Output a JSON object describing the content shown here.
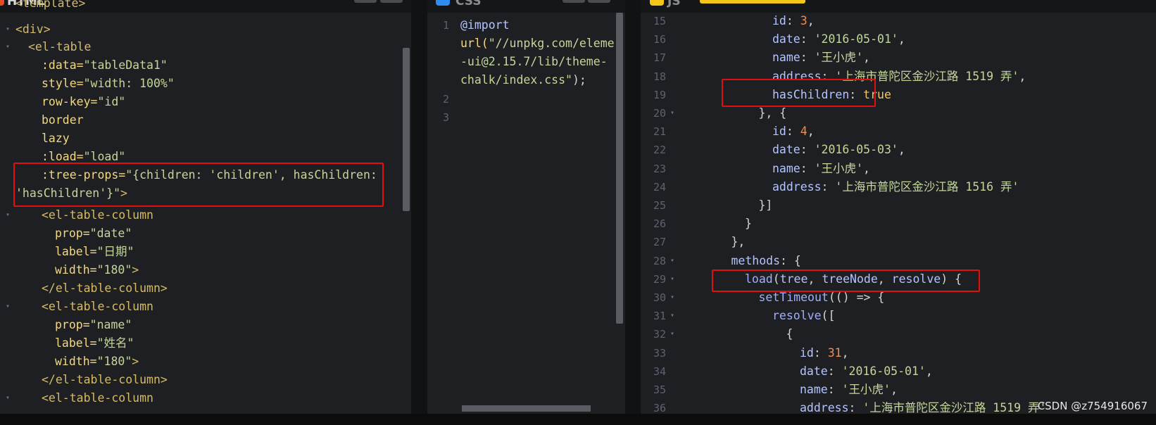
{
  "panels": {
    "html_tab": "HTML",
    "css_tab": "CSS",
    "js_tab": "JS",
    "css_tab_icon": "css-badge-icon",
    "js_tab_icon": "js-badge-icon",
    "html_tab_icon": "html-badge-icon"
  },
  "html_code": {
    "l0": "<template>",
    "l1": "<div>",
    "l2": "<el-table",
    "l3a": ":data=",
    "l3b": "\"tableData1\"",
    "l4a": "style=",
    "l4b": "\"width: 100%\"",
    "l5a": "row-key=",
    "l5b": "\"id\"",
    "l6": "border",
    "l7": "lazy",
    "l8a": ":load=",
    "l8b": "\"load\"",
    "l9a": ":tree-props=",
    "l9b": "\"{children: 'children', hasChildren:",
    "l10a": "'hasChildren'}\"",
    "l10b": ">",
    "l11": "<el-table-column",
    "l12a": "prop=",
    "l12b": "\"date\"",
    "l13a": "label=",
    "l13b": "\"日期\"",
    "l14a": "width=",
    "l14b": "\"180\"",
    "l14c": ">",
    "l15": "</el-table-column>",
    "l16": "<el-table-column",
    "l17a": "prop=",
    "l17b": "\"name\"",
    "l18a": "label=",
    "l18b": "\"姓名\"",
    "l19a": "width=",
    "l19b": "\"180\"",
    "l19c": ">",
    "l20": "</el-table-column>",
    "l21": "<el-table-column"
  },
  "css_code": {
    "n1": "1",
    "n2": "2",
    "n3": "3",
    "l1": "@import",
    "l2a": "url(",
    "l2b": "\"//unpkg.com/eleme",
    "l3": "-ui@2.15.7/lib/theme-",
    "l4": "chalk/index.css\"",
    "l4b": ");"
  },
  "js_code": {
    "lines": [
      {
        "n": "15",
        "text": [
          [
            "prop",
            "id"
          ],
          [
            "pun",
            ": "
          ],
          [
            "num",
            "3"
          ],
          [
            "pun",
            ","
          ]
        ],
        "indent": 6
      },
      {
        "n": "16",
        "text": [
          [
            "prop",
            "date"
          ],
          [
            "pun",
            ": "
          ],
          [
            "str",
            "'2016-05-01'"
          ],
          [
            "pun",
            ","
          ]
        ],
        "indent": 6
      },
      {
        "n": "17",
        "text": [
          [
            "prop",
            "name"
          ],
          [
            "pun",
            ": "
          ],
          [
            "str",
            "'王小虎'"
          ],
          [
            "pun",
            ","
          ]
        ],
        "indent": 6
      },
      {
        "n": "18",
        "text": [
          [
            "prop",
            "address"
          ],
          [
            "pun",
            ": "
          ],
          [
            "str",
            "'上海市普陀区金沙江路 1519 弄'"
          ],
          [
            "pun",
            ","
          ]
        ],
        "indent": 6
      },
      {
        "n": "19",
        "text": [
          [
            "prop",
            "hasChildren"
          ],
          [
            "pun",
            ": "
          ],
          [
            "kw",
            "true"
          ]
        ],
        "indent": 6
      },
      {
        "n": "20",
        "text": [
          [
            "pun",
            "}, {"
          ]
        ],
        "indent": 5,
        "fold": true
      },
      {
        "n": "21",
        "text": [
          [
            "prop",
            "id"
          ],
          [
            "pun",
            ": "
          ],
          [
            "num",
            "4"
          ],
          [
            "pun",
            ","
          ]
        ],
        "indent": 6
      },
      {
        "n": "22",
        "text": [
          [
            "prop",
            "date"
          ],
          [
            "pun",
            ": "
          ],
          [
            "str",
            "'2016-05-03'"
          ],
          [
            "pun",
            ","
          ]
        ],
        "indent": 6
      },
      {
        "n": "23",
        "text": [
          [
            "prop",
            "name"
          ],
          [
            "pun",
            ": "
          ],
          [
            "str",
            "'王小虎'"
          ],
          [
            "pun",
            ","
          ]
        ],
        "indent": 6
      },
      {
        "n": "24",
        "text": [
          [
            "prop",
            "address"
          ],
          [
            "pun",
            ": "
          ],
          [
            "str",
            "'上海市普陀区金沙江路 1516 弄'"
          ]
        ],
        "indent": 6
      },
      {
        "n": "25",
        "text": [
          [
            "pun",
            "}]"
          ]
        ],
        "indent": 5
      },
      {
        "n": "26",
        "text": [
          [
            "pun",
            "}"
          ]
        ],
        "indent": 4
      },
      {
        "n": "27",
        "text": [
          [
            "pun",
            "},"
          ]
        ],
        "indent": 3
      },
      {
        "n": "28",
        "text": [
          [
            "prop",
            "methods"
          ],
          [
            "pun",
            ": {"
          ]
        ],
        "indent": 3,
        "fold": true
      },
      {
        "n": "29",
        "text": [
          [
            "fn",
            "load"
          ],
          [
            "pun",
            "("
          ],
          [
            "prop",
            "tree"
          ],
          [
            "pun",
            ", "
          ],
          [
            "prop",
            "treeNode"
          ],
          [
            "pun",
            ", "
          ],
          [
            "prop",
            "resolve"
          ],
          [
            "pun",
            ") {"
          ]
        ],
        "indent": 4,
        "fold": true
      },
      {
        "n": "30",
        "text": [
          [
            "fn",
            "setTimeout"
          ],
          [
            "pun",
            "(() => {"
          ]
        ],
        "indent": 5,
        "fold": true
      },
      {
        "n": "31",
        "text": [
          [
            "fn",
            "resolve"
          ],
          [
            "pun",
            "(["
          ]
        ],
        "indent": 6,
        "fold": true
      },
      {
        "n": "32",
        "text": [
          [
            "pun",
            "{"
          ]
        ],
        "indent": 7,
        "fold": true
      },
      {
        "n": "33",
        "text": [
          [
            "prop",
            "id"
          ],
          [
            "pun",
            ": "
          ],
          [
            "num",
            "31"
          ],
          [
            "pun",
            ","
          ]
        ],
        "indent": 8
      },
      {
        "n": "34",
        "text": [
          [
            "prop",
            "date"
          ],
          [
            "pun",
            ": "
          ],
          [
            "str",
            "'2016-05-01'"
          ],
          [
            "pun",
            ","
          ]
        ],
        "indent": 8
      },
      {
        "n": "35",
        "text": [
          [
            "prop",
            "name"
          ],
          [
            "pun",
            ": "
          ],
          [
            "str",
            "'王小虎'"
          ],
          [
            "pun",
            ","
          ]
        ],
        "indent": 8
      },
      {
        "n": "36",
        "text": [
          [
            "prop",
            "address"
          ],
          [
            "pun",
            ": "
          ],
          [
            "str",
            "'上海市普陀区金沙江路 1519 弄'"
          ]
        ],
        "indent": 8
      }
    ]
  },
  "watermark": "CSDN @z754916067",
  "colors": {
    "highlight_box": "#e01010",
    "js_badge": "#f5c518",
    "css_badge": "#2f8cf0",
    "html_badge": "#e44d26"
  }
}
